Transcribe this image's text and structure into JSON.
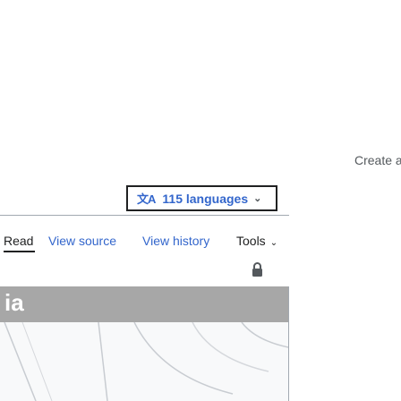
{
  "header": {
    "create_account": "Create a"
  },
  "languages": {
    "icon_glyph": "文A",
    "label": "115 languages",
    "chevron": "⌄"
  },
  "tabs": {
    "read": "Read",
    "view_source": "View source",
    "view_history": "View history",
    "tools": "Tools",
    "tools_chevron": "⌄"
  },
  "image": {
    "text": "ia"
  },
  "icons": {
    "protection": "lock-icon"
  },
  "colors": {
    "link": "#3366cc",
    "text": "#202122",
    "border": "#a2a9b1"
  }
}
